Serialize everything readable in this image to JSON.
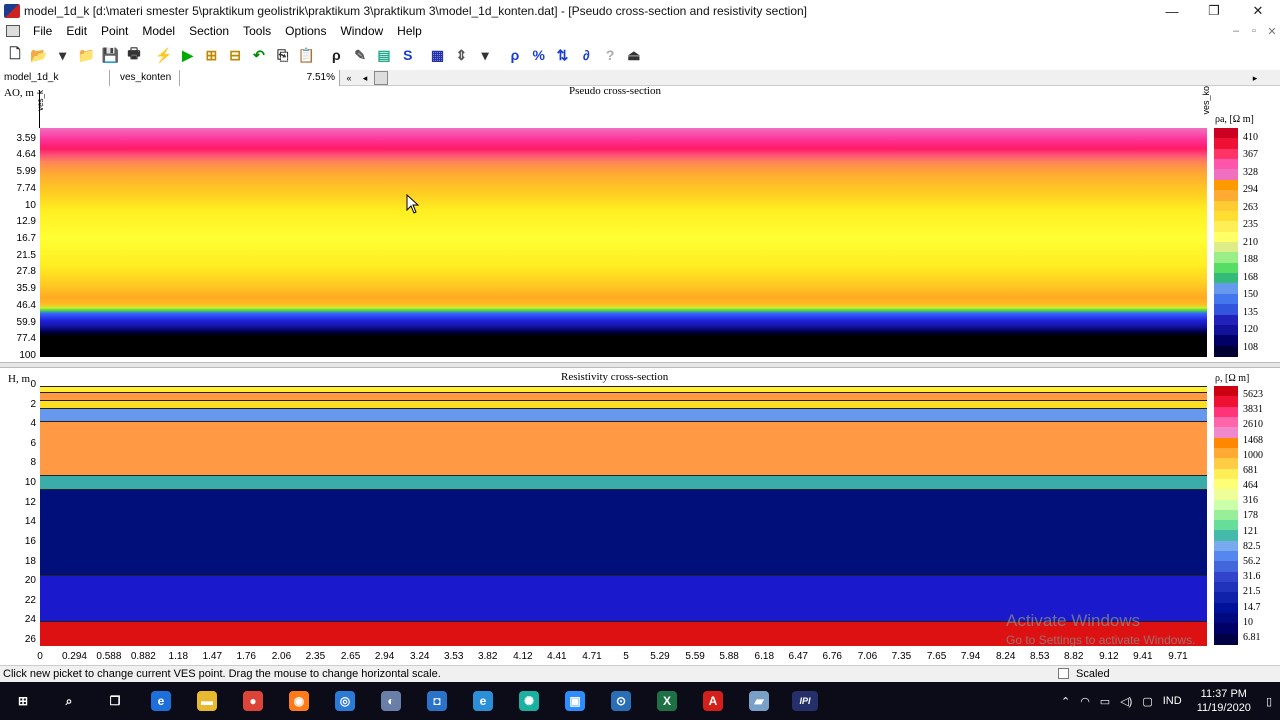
{
  "window": {
    "title": "model_1d_k [d:\\materi smester 5\\praktikum geolistrik\\praktikum 3\\praktikum 3\\model_1d_konten.dat] - [Pseudo cross-section and resistivity section]",
    "minimize": "—",
    "restore": "❐",
    "close": "✕"
  },
  "menu": [
    "File",
    "Edit",
    "Point",
    "Model",
    "Section",
    "Tools",
    "Options",
    "Window",
    "Help"
  ],
  "mdi_controls": [
    "–",
    "▫",
    "✕"
  ],
  "toolbar": {
    "buttons": [
      {
        "name": "new-icon",
        "glyph": "🗋",
        "color": "#333"
      },
      {
        "name": "open-icon",
        "glyph": "📂",
        "color": "#c90"
      },
      {
        "name": "open-dropdown-icon",
        "glyph": "▾",
        "color": "#333"
      },
      {
        "name": "open-folder-add-icon",
        "glyph": "📁",
        "color": "#c60"
      },
      {
        "name": "save-icon",
        "glyph": "💾",
        "color": "#333"
      },
      {
        "name": "print-icon",
        "glyph": "🖶",
        "color": "#333"
      },
      {
        "name": "lightning-icon",
        "glyph": "⚡",
        "color": "#cc0"
      },
      {
        "name": "run-icon",
        "glyph": "▶",
        "color": "#0a0"
      },
      {
        "name": "layers-icon",
        "glyph": "⊞",
        "color": "#b80"
      },
      {
        "name": "layers-split-icon",
        "glyph": "⊟",
        "color": "#b80"
      },
      {
        "name": "undo-icon",
        "glyph": "↶",
        "color": "#080"
      },
      {
        "name": "copy-icon",
        "glyph": "⎘",
        "color": "#333"
      },
      {
        "name": "paste-icon",
        "glyph": "📋",
        "color": "#333"
      },
      {
        "name": "rho-a-icon",
        "glyph": "ρ",
        "color": "#222"
      },
      {
        "name": "pen-icon",
        "glyph": "✎",
        "color": "#555"
      },
      {
        "name": "map-icon",
        "glyph": "▤",
        "color": "#2a8"
      },
      {
        "name": "s-icon",
        "glyph": "S",
        "color": "#1a3fd0"
      },
      {
        "name": "calc-icon",
        "glyph": "▦",
        "color": "#2233aa"
      },
      {
        "name": "zoom-icon",
        "glyph": "⇕",
        "color": "#555"
      },
      {
        "name": "zoom-dropdown-icon",
        "glyph": "▾",
        "color": "#333"
      },
      {
        "name": "rho-icon",
        "glyph": "ρ",
        "color": "#1a3fd0"
      },
      {
        "name": "percent-icon",
        "glyph": "%",
        "color": "#1a3fd0"
      },
      {
        "name": "sort-icon",
        "glyph": "⇅",
        "color": "#1a3fd0"
      },
      {
        "name": "partial-icon",
        "glyph": "∂",
        "color": "#1a3fd0"
      },
      {
        "name": "help-icon",
        "glyph": "?",
        "color": "#aaa"
      },
      {
        "name": "exit-icon",
        "glyph": "⏏",
        "color": "#333"
      }
    ]
  },
  "tabstrip": {
    "model_name": "model_1d_k",
    "ves_name": "ves_konten",
    "percent": "7.51%",
    "nav_first": "«",
    "nav_prev": "◂",
    "nav_next": "▸"
  },
  "pseudo": {
    "title": "Pseudo cross-section",
    "axis_label": "AO, m",
    "ves_label_left": "ves_k",
    "ves_label_right": "ves_ko",
    "y_ticks": [
      "3.59",
      "4.64",
      "5.99",
      "7.74",
      "10",
      "12.9",
      "16.7",
      "21.5",
      "27.8",
      "35.9",
      "46.4",
      "59.9",
      "77.4",
      "100"
    ],
    "colorbar_label": "ρa, [Ω m]",
    "colorbar_ticks": [
      "410",
      "367",
      "328",
      "294",
      "263",
      "235",
      "210",
      "188",
      "168",
      "150",
      "135",
      "120",
      "108"
    ]
  },
  "resistivity": {
    "title": "Resistivity cross-section",
    "axis_label": "H, m",
    "y_ticks": [
      "0",
      "2",
      "4",
      "6",
      "8",
      "10",
      "12",
      "14",
      "16",
      "18",
      "20",
      "22",
      "24",
      "26"
    ],
    "colorbar_label": "ρ, [Ω m]",
    "colorbar_ticks": [
      "5623",
      "3831",
      "2610",
      "1468",
      "1000",
      "681",
      "464",
      "316",
      "178",
      "121",
      "82.5",
      "56.2",
      "31.6",
      "21.5",
      "14.7",
      "10",
      "6.81"
    ],
    "layers": [
      {
        "top": 0.0,
        "bottom": 0.6,
        "color": "#ffee33"
      },
      {
        "top": 0.6,
        "bottom": 1.4,
        "color": "#ff9944"
      },
      {
        "top": 1.4,
        "bottom": 2.2,
        "color": "#ffdd22"
      },
      {
        "top": 2.2,
        "bottom": 3.6,
        "color": "#6699ee"
      },
      {
        "top": 3.6,
        "bottom": 9.1,
        "color": "#ff9944"
      },
      {
        "top": 9.1,
        "bottom": 10.5,
        "color": "#3aadaa"
      },
      {
        "top": 10.5,
        "bottom": 19.3,
        "color": "#000f7a"
      },
      {
        "top": 19.3,
        "bottom": 24.0,
        "color": "#1a1acc"
      },
      {
        "top": 24.0,
        "bottom": 26.5,
        "color": "#dd1111"
      }
    ]
  },
  "x_axis": {
    "ticks": [
      "0",
      "0.294",
      "0.588",
      "0.882",
      "1.18",
      "1.47",
      "1.76",
      "2.06",
      "2.35",
      "2.65",
      "2.94",
      "3.24",
      "3.53",
      "3.82",
      "4.12",
      "4.41",
      "4.71",
      "5",
      "5.29",
      "5.59",
      "5.88",
      "6.18",
      "6.47",
      "6.76",
      "7.06",
      "7.35",
      "7.65",
      "7.94",
      "8.24",
      "8.53",
      "8.82",
      "9.12",
      "9.41",
      "9.71"
    ]
  },
  "status": {
    "message": "Click new picket to change current VES point. Drag the mouse to change horizontal scale.",
    "scaled_label": "Scaled"
  },
  "watermark": {
    "line1": "Activate Windows",
    "line2": "Go to Settings to activate Windows."
  },
  "taskbar": {
    "apps": [
      {
        "name": "start-icon",
        "glyph": "⊞",
        "bg": "transparent"
      },
      {
        "name": "search-icon",
        "glyph": "⌕",
        "bg": "transparent"
      },
      {
        "name": "task-view-icon",
        "glyph": "❐",
        "bg": "transparent"
      },
      {
        "name": "edge-icon",
        "glyph": "e",
        "bg": "#1e6fd9"
      },
      {
        "name": "file-explorer-icon",
        "glyph": "▬",
        "bg": "#e8b92f"
      },
      {
        "name": "chrome-icon",
        "glyph": "●",
        "bg": "#db4437"
      },
      {
        "name": "firefox-icon",
        "glyph": "◉",
        "bg": "#ff7a1a"
      },
      {
        "name": "browser-icon",
        "glyph": "◎",
        "bg": "#2b7bd6"
      },
      {
        "name": "media-icon",
        "glyph": "◐",
        "bg": "#6a7fa8"
      },
      {
        "name": "app-orange-icon",
        "glyph": "◘",
        "bg": "#2a73c9"
      },
      {
        "name": "ie-icon",
        "glyph": "e",
        "bg": "#2a8fd6"
      },
      {
        "name": "network-app-icon",
        "glyph": "✺",
        "bg": "#1bb0a0"
      },
      {
        "name": "zoom-app-icon",
        "glyph": "▣",
        "bg": "#2d8cff"
      },
      {
        "name": "viewer-icon",
        "glyph": "⊙",
        "bg": "#2a6fb5"
      },
      {
        "name": "excel-icon",
        "glyph": "X",
        "bg": "#1e7145"
      },
      {
        "name": "pdf-icon",
        "glyph": "A",
        "bg": "#d4201a"
      },
      {
        "name": "notes-icon",
        "glyph": "▰",
        "bg": "#7aa0c8"
      },
      {
        "name": "ipi-icon",
        "glyph": "IPI",
        "bg": "#25306a"
      }
    ],
    "tray": {
      "chevron": "⌃",
      "network": "◠",
      "battery": "▭",
      "volume": "◁)",
      "message": "▢",
      "language": "IND",
      "time": "11:37 PM",
      "date": "11/19/2020",
      "notify": "▯"
    }
  }
}
